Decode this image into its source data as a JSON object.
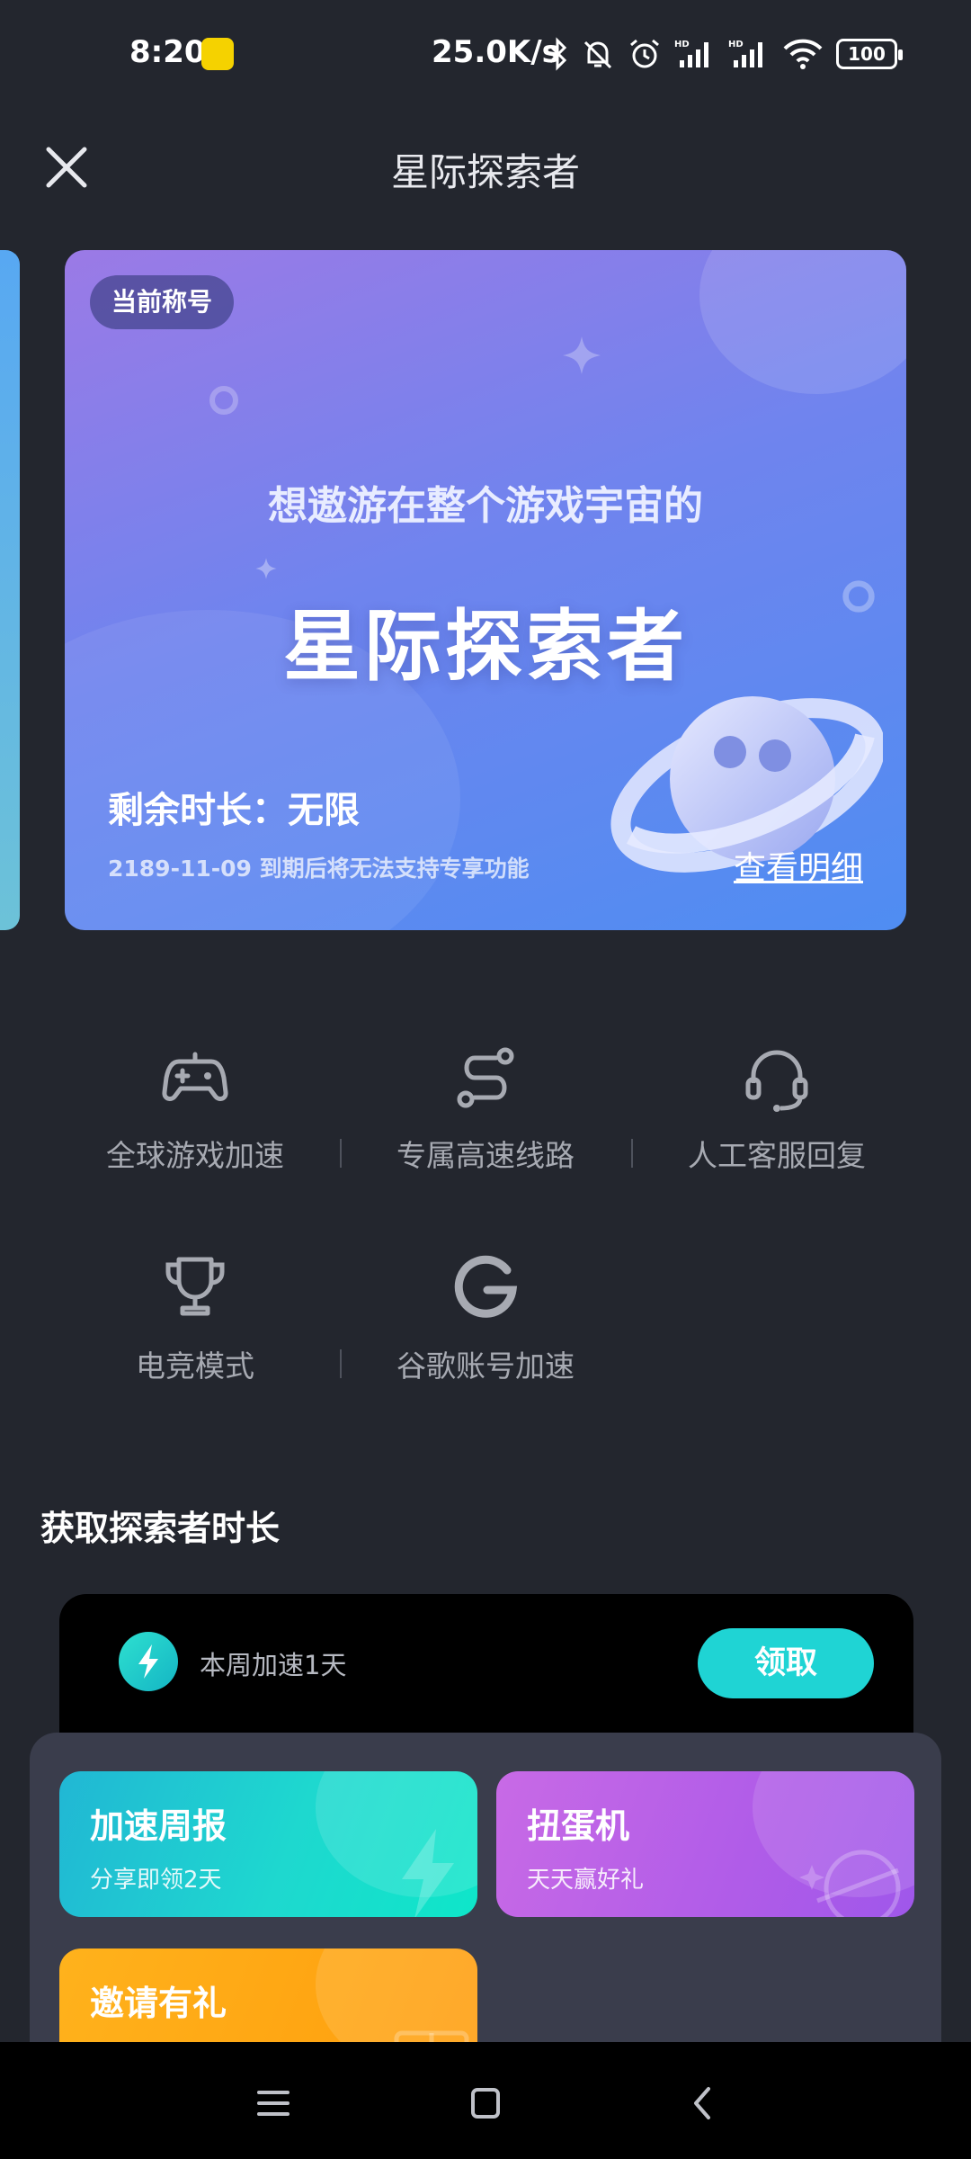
{
  "status_bar": {
    "time": "8:20",
    "net_speed": "25.0K/s",
    "battery": "100",
    "icons": [
      "bluetooth-icon",
      "mute-bell-icon",
      "alarm-icon",
      "hd-signal-icon",
      "hd-signal-icon",
      "wifi-icon",
      "battery-icon"
    ]
  },
  "header": {
    "title": "星际探索者",
    "close_icon": "close-icon"
  },
  "title_card": {
    "badge": "当前称号",
    "subtitle": "想遨游在整个游戏宇宙的",
    "title": "星际探索者",
    "remaining": "剩余时长：无限",
    "expire_note": "2189-11-09 到期后将无法支持专享功能",
    "detail_link": "查看明细"
  },
  "features": [
    {
      "label": "全球游戏加速",
      "icon": "gamepad-icon"
    },
    {
      "label": "专属高速线路",
      "icon": "route-icon"
    },
    {
      "label": "人工客服回复",
      "icon": "headset-icon"
    },
    {
      "label": "电竞模式",
      "icon": "trophy-icon"
    },
    {
      "label": "谷歌账号加速",
      "icon": "google-g-icon"
    }
  ],
  "earn_section": {
    "title": "获取探索者时长",
    "task": {
      "label": "本周加速1天",
      "button": "领取",
      "icon": "lightning-icon"
    }
  },
  "tiles": [
    {
      "title": "加速周报",
      "subtitle": "分享即领2天",
      "color": "#1ed8cf"
    },
    {
      "title": "扭蛋机",
      "subtitle": "天天赢好礼",
      "color": "#b05ce8"
    },
    {
      "title": "邀请有礼",
      "subtitle": "",
      "color": "#ffa514"
    }
  ],
  "nav_bar": {
    "icons": [
      "menu-icon",
      "home-square-icon",
      "back-chevron-icon"
    ]
  }
}
